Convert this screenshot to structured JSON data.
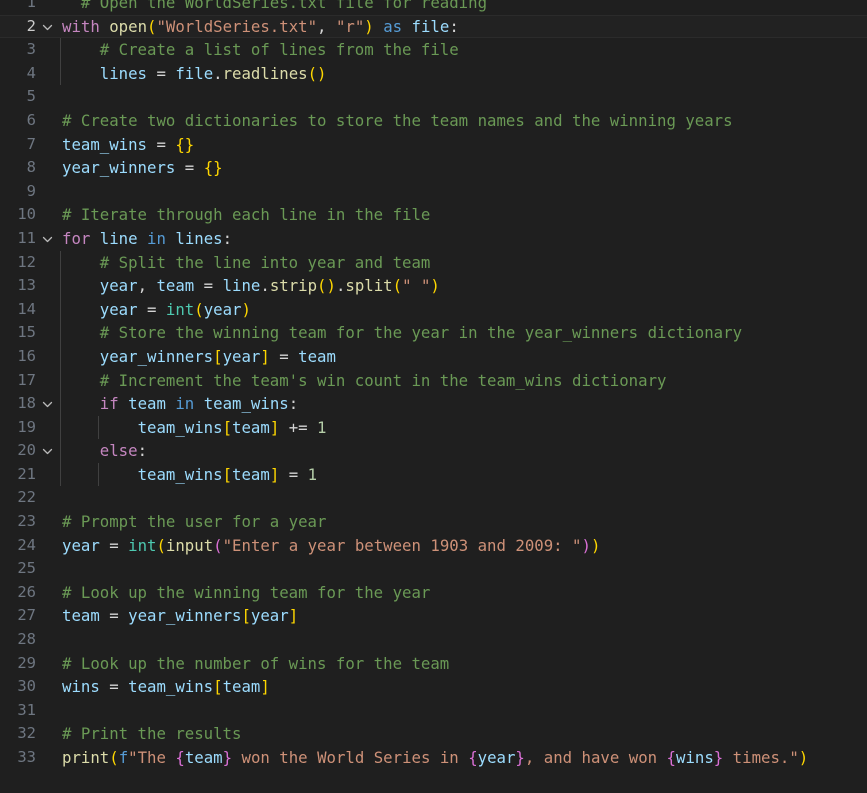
{
  "editor": {
    "language": "python",
    "file_name": "WorldSeries.txt",
    "background_color": "#1f1f1f",
    "active_line_color": "#222222",
    "gutter_color": "#6e7681",
    "active_line_number": 2,
    "total_visible_lines": 33,
    "fold_icon": "chevron-down-icon",
    "theme": {
      "comment": "#6a9955",
      "keyword": "#c586c0",
      "keyword_operator": "#569cd6",
      "function": "#dcdcaa",
      "type": "#4ec9b0",
      "variable": "#9cdcfe",
      "string": "#ce9178",
      "number": "#b5cea8",
      "bracket_1": "#ffd700",
      "bracket_2": "#da70d6",
      "bracket_3": "#179fff",
      "foreground": "#d4d4d4"
    }
  },
  "lines": [
    {
      "number": 1,
      "fold": false,
      "active": false,
      "guides": 0,
      "tokens": [
        {
          "t": "  # Open the WorldSeries.txt file for reading",
          "c": "t-cmt"
        }
      ]
    },
    {
      "number": 2,
      "fold": true,
      "active": true,
      "guides": 0,
      "tokens": [
        {
          "t": "with",
          "c": "t-kw"
        },
        {
          "t": " ",
          "c": "t-plain"
        },
        {
          "t": "open",
          "c": "t-fn"
        },
        {
          "t": "(",
          "c": "t-b1"
        },
        {
          "t": "\"WorldSeries.txt\"",
          "c": "t-str"
        },
        {
          "t": ",",
          "c": "t-op"
        },
        {
          "t": " ",
          "c": "t-plain"
        },
        {
          "t": "\"r\"",
          "c": "t-str"
        },
        {
          "t": ")",
          "c": "t-b1"
        },
        {
          "t": " ",
          "c": "t-plain"
        },
        {
          "t": "as",
          "c": "t-kw2"
        },
        {
          "t": " ",
          "c": "t-plain"
        },
        {
          "t": "file",
          "c": "t-var"
        },
        {
          "t": ":",
          "c": "t-op"
        }
      ]
    },
    {
      "number": 3,
      "fold": false,
      "active": false,
      "guides": 1,
      "tokens": [
        {
          "t": "    # Create a list of lines from the file",
          "c": "t-cmt"
        }
      ]
    },
    {
      "number": 4,
      "fold": false,
      "active": false,
      "guides": 1,
      "tokens": [
        {
          "t": "    ",
          "c": "t-plain"
        },
        {
          "t": "lines",
          "c": "t-var"
        },
        {
          "t": " = ",
          "c": "t-op"
        },
        {
          "t": "file",
          "c": "t-var"
        },
        {
          "t": ".",
          "c": "t-op"
        },
        {
          "t": "readlines",
          "c": "t-fn"
        },
        {
          "t": "()",
          "c": "t-b1"
        }
      ]
    },
    {
      "number": 5,
      "fold": false,
      "active": false,
      "guides": 0,
      "tokens": []
    },
    {
      "number": 6,
      "fold": false,
      "active": false,
      "guides": 0,
      "tokens": [
        {
          "t": "# Create two dictionaries to store the team names and the winning years",
          "c": "t-cmt"
        }
      ]
    },
    {
      "number": 7,
      "fold": false,
      "active": false,
      "guides": 0,
      "tokens": [
        {
          "t": "team_wins",
          "c": "t-var"
        },
        {
          "t": " = ",
          "c": "t-op"
        },
        {
          "t": "{}",
          "c": "t-b1"
        }
      ]
    },
    {
      "number": 8,
      "fold": false,
      "active": false,
      "guides": 0,
      "tokens": [
        {
          "t": "year_winners",
          "c": "t-var"
        },
        {
          "t": " = ",
          "c": "t-op"
        },
        {
          "t": "{}",
          "c": "t-b1"
        }
      ]
    },
    {
      "number": 9,
      "fold": false,
      "active": false,
      "guides": 0,
      "tokens": []
    },
    {
      "number": 10,
      "fold": false,
      "active": false,
      "guides": 0,
      "tokens": [
        {
          "t": "# Iterate through each line in the file",
          "c": "t-cmt"
        }
      ]
    },
    {
      "number": 11,
      "fold": true,
      "active": false,
      "guides": 0,
      "tokens": [
        {
          "t": "for",
          "c": "t-kw"
        },
        {
          "t": " ",
          "c": "t-plain"
        },
        {
          "t": "line",
          "c": "t-var"
        },
        {
          "t": " ",
          "c": "t-plain"
        },
        {
          "t": "in",
          "c": "t-kw2"
        },
        {
          "t": " ",
          "c": "t-plain"
        },
        {
          "t": "lines",
          "c": "t-var"
        },
        {
          "t": ":",
          "c": "t-op"
        }
      ]
    },
    {
      "number": 12,
      "fold": false,
      "active": false,
      "guides": 1,
      "tokens": [
        {
          "t": "    # Split the line into year and team",
          "c": "t-cmt"
        }
      ]
    },
    {
      "number": 13,
      "fold": false,
      "active": false,
      "guides": 1,
      "tokens": [
        {
          "t": "    ",
          "c": "t-plain"
        },
        {
          "t": "year",
          "c": "t-var"
        },
        {
          "t": ", ",
          "c": "t-op"
        },
        {
          "t": "team",
          "c": "t-var"
        },
        {
          "t": " = ",
          "c": "t-op"
        },
        {
          "t": "line",
          "c": "t-var"
        },
        {
          "t": ".",
          "c": "t-op"
        },
        {
          "t": "strip",
          "c": "t-fn"
        },
        {
          "t": "()",
          "c": "t-b1"
        },
        {
          "t": ".",
          "c": "t-op"
        },
        {
          "t": "split",
          "c": "t-fn"
        },
        {
          "t": "(",
          "c": "t-b1"
        },
        {
          "t": "\" \"",
          "c": "t-str"
        },
        {
          "t": ")",
          "c": "t-b1"
        }
      ]
    },
    {
      "number": 14,
      "fold": false,
      "active": false,
      "guides": 1,
      "tokens": [
        {
          "t": "    ",
          "c": "t-plain"
        },
        {
          "t": "year",
          "c": "t-var"
        },
        {
          "t": " = ",
          "c": "t-op"
        },
        {
          "t": "int",
          "c": "t-type"
        },
        {
          "t": "(",
          "c": "t-b1"
        },
        {
          "t": "year",
          "c": "t-var"
        },
        {
          "t": ")",
          "c": "t-b1"
        }
      ]
    },
    {
      "number": 15,
      "fold": false,
      "active": false,
      "guides": 1,
      "tokens": [
        {
          "t": "    # Store the winning team for the year in the year_winners dictionary",
          "c": "t-cmt"
        }
      ]
    },
    {
      "number": 16,
      "fold": false,
      "active": false,
      "guides": 1,
      "tokens": [
        {
          "t": "    ",
          "c": "t-plain"
        },
        {
          "t": "year_winners",
          "c": "t-var"
        },
        {
          "t": "[",
          "c": "t-b1"
        },
        {
          "t": "year",
          "c": "t-var"
        },
        {
          "t": "]",
          "c": "t-b1"
        },
        {
          "t": " = ",
          "c": "t-op"
        },
        {
          "t": "team",
          "c": "t-var"
        }
      ]
    },
    {
      "number": 17,
      "fold": false,
      "active": false,
      "guides": 1,
      "tokens": [
        {
          "t": "    # Increment the team's win count in the team_wins dictionary",
          "c": "t-cmt"
        }
      ]
    },
    {
      "number": 18,
      "fold": true,
      "active": false,
      "guides": 1,
      "tokens": [
        {
          "t": "    ",
          "c": "t-plain"
        },
        {
          "t": "if",
          "c": "t-kw"
        },
        {
          "t": " ",
          "c": "t-plain"
        },
        {
          "t": "team",
          "c": "t-var"
        },
        {
          "t": " ",
          "c": "t-plain"
        },
        {
          "t": "in",
          "c": "t-kw2"
        },
        {
          "t": " ",
          "c": "t-plain"
        },
        {
          "t": "team_wins",
          "c": "t-var"
        },
        {
          "t": ":",
          "c": "t-op"
        }
      ]
    },
    {
      "number": 19,
      "fold": false,
      "active": false,
      "guides": 2,
      "tokens": [
        {
          "t": "        ",
          "c": "t-plain"
        },
        {
          "t": "team_wins",
          "c": "t-var"
        },
        {
          "t": "[",
          "c": "t-b1"
        },
        {
          "t": "team",
          "c": "t-var"
        },
        {
          "t": "]",
          "c": "t-b1"
        },
        {
          "t": " += ",
          "c": "t-op"
        },
        {
          "t": "1",
          "c": "t-num"
        }
      ]
    },
    {
      "number": 20,
      "fold": true,
      "active": false,
      "guides": 1,
      "tokens": [
        {
          "t": "    ",
          "c": "t-plain"
        },
        {
          "t": "else",
          "c": "t-kw"
        },
        {
          "t": ":",
          "c": "t-op"
        }
      ]
    },
    {
      "number": 21,
      "fold": false,
      "active": false,
      "guides": 2,
      "tokens": [
        {
          "t": "        ",
          "c": "t-plain"
        },
        {
          "t": "team_wins",
          "c": "t-var"
        },
        {
          "t": "[",
          "c": "t-b1"
        },
        {
          "t": "team",
          "c": "t-var"
        },
        {
          "t": "]",
          "c": "t-b1"
        },
        {
          "t": " = ",
          "c": "t-op"
        },
        {
          "t": "1",
          "c": "t-num"
        }
      ]
    },
    {
      "number": 22,
      "fold": false,
      "active": false,
      "guides": 0,
      "tokens": []
    },
    {
      "number": 23,
      "fold": false,
      "active": false,
      "guides": 0,
      "tokens": [
        {
          "t": "# Prompt the user for a year",
          "c": "t-cmt"
        }
      ]
    },
    {
      "number": 24,
      "fold": false,
      "active": false,
      "guides": 0,
      "tokens": [
        {
          "t": "year",
          "c": "t-var"
        },
        {
          "t": " = ",
          "c": "t-op"
        },
        {
          "t": "int",
          "c": "t-type"
        },
        {
          "t": "(",
          "c": "t-b1"
        },
        {
          "t": "input",
          "c": "t-fn"
        },
        {
          "t": "(",
          "c": "t-b2"
        },
        {
          "t": "\"Enter a year between 1903 and 2009: \"",
          "c": "t-str"
        },
        {
          "t": ")",
          "c": "t-b2"
        },
        {
          "t": ")",
          "c": "t-b1"
        }
      ]
    },
    {
      "number": 25,
      "fold": false,
      "active": false,
      "guides": 0,
      "tokens": []
    },
    {
      "number": 26,
      "fold": false,
      "active": false,
      "guides": 0,
      "tokens": [
        {
          "t": "# Look up the winning team for the year",
          "c": "t-cmt"
        }
      ]
    },
    {
      "number": 27,
      "fold": false,
      "active": false,
      "guides": 0,
      "tokens": [
        {
          "t": "team",
          "c": "t-var"
        },
        {
          "t": " = ",
          "c": "t-op"
        },
        {
          "t": "year_winners",
          "c": "t-var"
        },
        {
          "t": "[",
          "c": "t-b1"
        },
        {
          "t": "year",
          "c": "t-var"
        },
        {
          "t": "]",
          "c": "t-b1"
        }
      ]
    },
    {
      "number": 28,
      "fold": false,
      "active": false,
      "guides": 0,
      "tokens": []
    },
    {
      "number": 29,
      "fold": false,
      "active": false,
      "guides": 0,
      "tokens": [
        {
          "t": "# Look up the number of wins for the team",
          "c": "t-cmt"
        }
      ]
    },
    {
      "number": 30,
      "fold": false,
      "active": false,
      "guides": 0,
      "tokens": [
        {
          "t": "wins",
          "c": "t-var"
        },
        {
          "t": " = ",
          "c": "t-op"
        },
        {
          "t": "team_wins",
          "c": "t-var"
        },
        {
          "t": "[",
          "c": "t-b1"
        },
        {
          "t": "team",
          "c": "t-var"
        },
        {
          "t": "]",
          "c": "t-b1"
        }
      ]
    },
    {
      "number": 31,
      "fold": false,
      "active": false,
      "guides": 0,
      "tokens": []
    },
    {
      "number": 32,
      "fold": false,
      "active": false,
      "guides": 0,
      "tokens": [
        {
          "t": "# Print the results",
          "c": "t-cmt"
        }
      ]
    },
    {
      "number": 33,
      "fold": false,
      "active": false,
      "guides": 0,
      "tokens": [
        {
          "t": "print",
          "c": "t-fn"
        },
        {
          "t": "(",
          "c": "t-b1"
        },
        {
          "t": "f",
          "c": "t-fpfx"
        },
        {
          "t": "\"The ",
          "c": "t-str"
        },
        {
          "t": "{",
          "c": "t-b2"
        },
        {
          "t": "team",
          "c": "t-var"
        },
        {
          "t": "}",
          "c": "t-b2"
        },
        {
          "t": " won the World Series in ",
          "c": "t-str"
        },
        {
          "t": "{",
          "c": "t-b2"
        },
        {
          "t": "year",
          "c": "t-var"
        },
        {
          "t": "}",
          "c": "t-b2"
        },
        {
          "t": ", and have won ",
          "c": "t-str"
        },
        {
          "t": "{",
          "c": "t-b2"
        },
        {
          "t": "wins",
          "c": "t-var"
        },
        {
          "t": "}",
          "c": "t-b2"
        },
        {
          "t": " times.\"",
          "c": "t-str"
        },
        {
          "t": ")",
          "c": "t-b1"
        }
      ]
    }
  ]
}
